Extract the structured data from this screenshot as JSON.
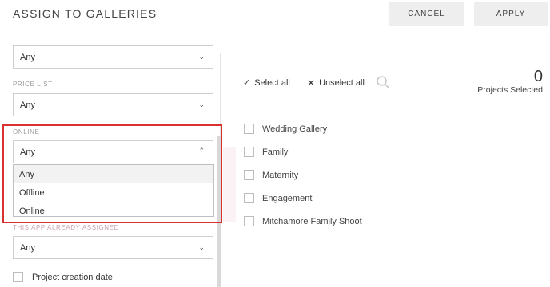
{
  "header": {
    "title": "ASSIGN TO GALLERIES",
    "cancel_label": "CANCEL",
    "apply_label": "APPLY"
  },
  "filters": {
    "first_value": "Any",
    "price_list_label": "PRICE LIST",
    "price_list_value": "Any",
    "online_label": "ONLINE",
    "online_value": "Any",
    "online_options": [
      "Any",
      "Offline",
      "Online"
    ],
    "app_assigned_label": "THIS APP ALREADY ASSIGNED",
    "app_assigned_value": "Any",
    "project_creation_date_label": "Project creation date"
  },
  "toolbar": {
    "select_all_label": "Select all",
    "unselect_all_label": "Unselect all"
  },
  "selection": {
    "count": "0",
    "count_label": "Projects Selected"
  },
  "galleries": [
    "Wedding Gallery",
    "Family",
    "Maternity",
    "Engagement",
    "Mitchamore Family Shoot"
  ],
  "colors": {
    "highlight": "#d93030",
    "button_bg": "#eeeeee"
  }
}
